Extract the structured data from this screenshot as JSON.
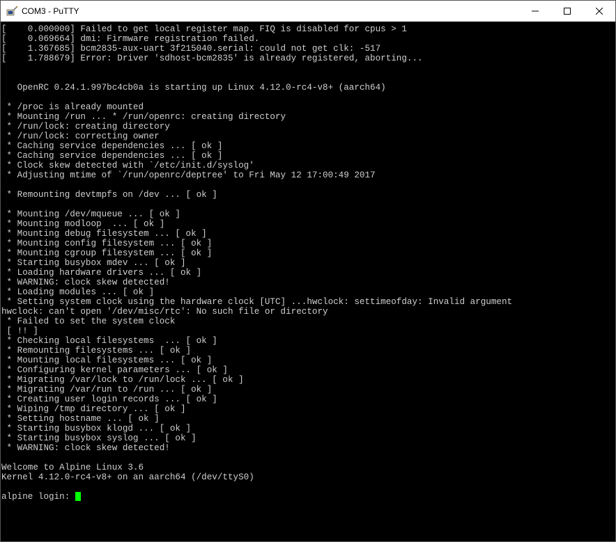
{
  "titlebar": {
    "icon_name": "putty-icon",
    "title": "COM3 - PuTTY",
    "minimize_tip": "Minimize",
    "maximize_tip": "Maximize",
    "close_tip": "Close"
  },
  "terminal": {
    "lines": [
      "[    0.000000] Failed to get local register map. FIQ is disabled for cpus > 1",
      "[    0.069664] dmi: Firmware registration failed.",
      "[    1.367685] bcm2835-aux-uart 3f215040.serial: could not get clk: -517",
      "[    1.788679] Error: Driver 'sdhost-bcm2835' is already registered, aborting...",
      "",
      "",
      "   OpenRC 0.24.1.997bc4cb0a is starting up Linux 4.12.0-rc4-v8+ (aarch64)",
      "",
      " * /proc is already mounted",
      " * Mounting /run ... * /run/openrc: creating directory",
      " * /run/lock: creating directory",
      " * /run/lock: correcting owner",
      " * Caching service dependencies ... [ ok ]",
      " * Caching service dependencies ... [ ok ]",
      " * Clock skew detected with `/etc/init.d/syslog'",
      " * Adjusting mtime of `/run/openrc/deptree' to Fri May 12 17:00:49 2017",
      "",
      " * Remounting devtmpfs on /dev ... [ ok ]",
      "",
      " * Mounting /dev/mqueue ... [ ok ]",
      " * Mounting modloop  ... [ ok ]",
      " * Mounting debug filesystem ... [ ok ]",
      " * Mounting config filesystem ... [ ok ]",
      " * Mounting cgroup filesystem ... [ ok ]",
      " * Starting busybox mdev ... [ ok ]",
      " * Loading hardware drivers ... [ ok ]",
      " * WARNING: clock skew detected!",
      " * Loading modules ... [ ok ]",
      " * Setting system clock using the hardware clock [UTC] ...hwclock: settimeofday: Invalid argument",
      "hwclock: can't open '/dev/misc/rtc': No such file or directory",
      " * Failed to set the system clock",
      " [ !! ]",
      " * Checking local filesystems  ... [ ok ]",
      " * Remounting filesystems ... [ ok ]",
      " * Mounting local filesystems ... [ ok ]",
      " * Configuring kernel parameters ... [ ok ]",
      " * Migrating /var/lock to /run/lock ... [ ok ]",
      " * Migrating /var/run to /run ... [ ok ]",
      " * Creating user login records ... [ ok ]",
      " * Wiping /tmp directory ... [ ok ]",
      " * Setting hostname ... [ ok ]",
      " * Starting busybox klogd ... [ ok ]",
      " * Starting busybox syslog ... [ ok ]",
      " * WARNING: clock skew detected!",
      "",
      "Welcome to Alpine Linux 3.6",
      "Kernel 4.12.0-rc4-v8+ on an aarch64 (/dev/ttyS0)",
      "",
      "alpine login: "
    ],
    "prompt": "alpine login: "
  }
}
